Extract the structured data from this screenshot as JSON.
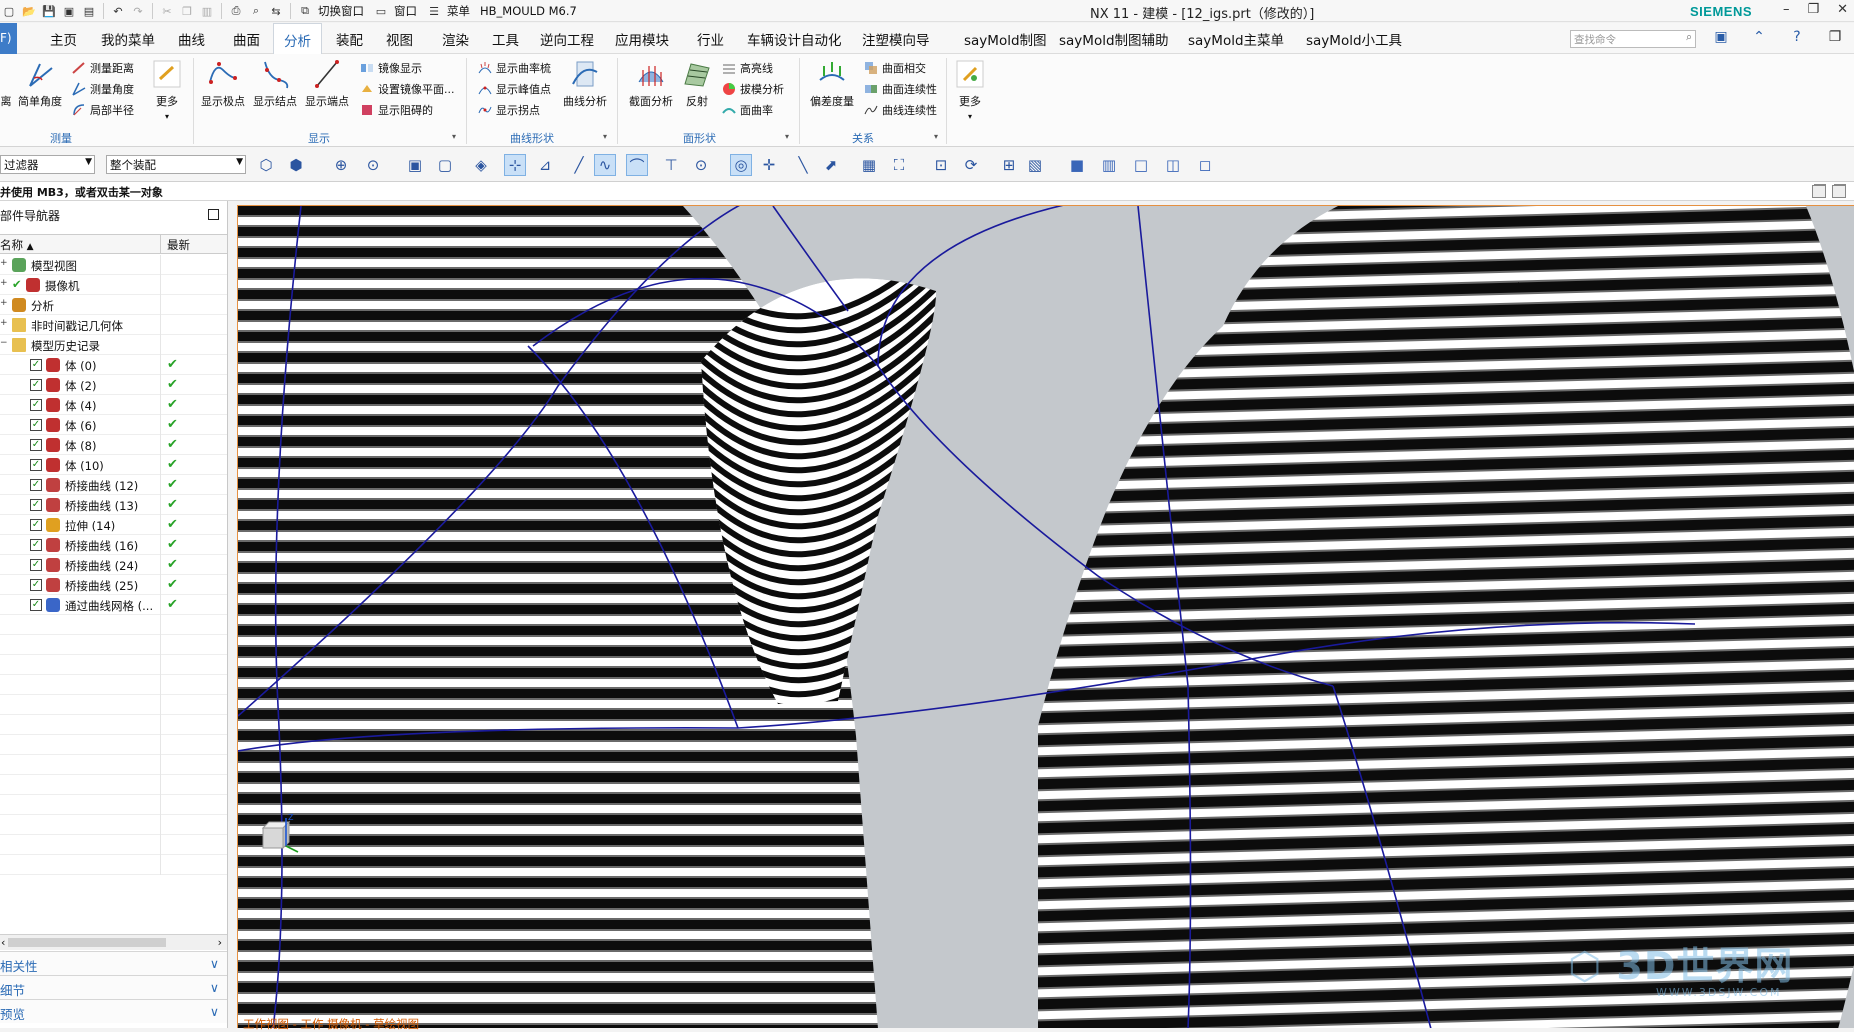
{
  "window": {
    "title": "NX 11 - 建模 - [12_igs.prt（修改的）]",
    "brand": "SIEMENS",
    "qa_switch_window": "切换窗口",
    "qa_window": "窗口",
    "qa_menu": "菜单",
    "qa_app": "HB_MOULD M6.7"
  },
  "menu": {
    "file": "F)",
    "tabs": [
      "主页",
      "我的菜单",
      "曲线",
      "曲面",
      "分析",
      "装配",
      "视图",
      "渲染",
      "工具",
      "逆向工程",
      "应用模块",
      "行业",
      "车辆设计自动化",
      "注塑模向导",
      "sayMold制图",
      "sayMold制图辅助",
      "sayMold主菜单",
      "sayMold小工具"
    ],
    "active_index": 4,
    "search_placeholder": "查找命令"
  },
  "ribbon": {
    "measure": {
      "group_label": "测量",
      "partial": "离",
      "simple_angle": "简单角度",
      "measure_distance": "测量距离",
      "measure_angle": "测量角度",
      "local_radius": "局部半径",
      "more": "更多"
    },
    "display": {
      "group_label": "显示",
      "show_poles": "显示极点",
      "show_knots": "显示结点",
      "show_endpoints": "显示端点",
      "mirror_display": "镜像显示",
      "set_mirror_plane": "设置镜像平面...",
      "show_thickness": "显示阻碍的"
    },
    "curve_shape": {
      "group_label": "曲线形状",
      "show_comb": "显示曲率梳",
      "show_peaks": "显示峰值点",
      "show_inflections": "显示拐点",
      "curve_analysis": "曲线分析"
    },
    "face_shape": {
      "group_label": "面形状",
      "section_analysis": "截面分析",
      "reflection": "反射",
      "highlight_lines": "高亮线",
      "draft_analysis": "拔模分析",
      "face_curvature": "面曲率"
    },
    "relation": {
      "group_label": "关系",
      "deviation": "偏差度量",
      "face_intersection": "曲面相交",
      "face_continuity": "曲面连续性",
      "curve_continuity": "曲线连续性"
    },
    "more": "更多"
  },
  "toolbar2": {
    "filter": "过滤器",
    "scope": "整个装配"
  },
  "prompt": "并使用 MB3，或者双击某一对象",
  "navigator": {
    "title": "部件导航器",
    "col_name": "名称",
    "col_latest": "最新",
    "items": [
      {
        "label": "模型视图",
        "indent": 0,
        "expander": "+",
        "checkbox": false,
        "latest": false,
        "icon": "model-views-icon"
      },
      {
        "label": "摄像机",
        "indent": 0,
        "expander": "+",
        "checkbox": false,
        "latest": false,
        "icon": "camera-icon"
      },
      {
        "label": "分析",
        "indent": 0,
        "expander": "+",
        "checkbox": false,
        "latest": false,
        "icon": "analysis-icon"
      },
      {
        "label": "非时间戳记几何体",
        "indent": 0,
        "expander": "+",
        "checkbox": false,
        "latest": false,
        "icon": "folder-icon"
      },
      {
        "label": "模型历史记录",
        "indent": 0,
        "expander": "-",
        "checkbox": false,
        "latest": false,
        "icon": "folder-icon"
      },
      {
        "label": "体 (0)",
        "indent": 1,
        "checkbox": true,
        "latest": true,
        "icon": "body-icon"
      },
      {
        "label": "体 (2)",
        "indent": 1,
        "checkbox": true,
        "latest": true,
        "icon": "body-icon"
      },
      {
        "label": "体 (4)",
        "indent": 1,
        "checkbox": true,
        "latest": true,
        "icon": "body-icon"
      },
      {
        "label": "体 (6)",
        "indent": 1,
        "checkbox": true,
        "latest": true,
        "icon": "body-icon"
      },
      {
        "label": "体 (8)",
        "indent": 1,
        "checkbox": true,
        "latest": true,
        "icon": "body-icon"
      },
      {
        "label": "体 (10)",
        "indent": 1,
        "checkbox": true,
        "latest": true,
        "icon": "body-icon"
      },
      {
        "label": "桥接曲线 (12)",
        "indent": 1,
        "checkbox": true,
        "latest": true,
        "icon": "bridge-curve-icon"
      },
      {
        "label": "桥接曲线 (13)",
        "indent": 1,
        "checkbox": true,
        "latest": true,
        "icon": "bridge-curve-icon"
      },
      {
        "label": "拉伸 (14)",
        "indent": 1,
        "checkbox": true,
        "latest": true,
        "icon": "extrude-icon"
      },
      {
        "label": "桥接曲线 (16)",
        "indent": 1,
        "checkbox": true,
        "latest": true,
        "icon": "bridge-curve-icon"
      },
      {
        "label": "桥接曲线 (24)",
        "indent": 1,
        "checkbox": true,
        "latest": true,
        "icon": "bridge-curve-icon"
      },
      {
        "label": "桥接曲线 (25)",
        "indent": 1,
        "checkbox": true,
        "latest": true,
        "icon": "bridge-curve-icon"
      },
      {
        "label": "通过曲线网格 (...",
        "indent": 1,
        "checkbox": true,
        "latest": true,
        "icon": "curve-mesh-icon"
      }
    ],
    "panels": [
      "相关性",
      "细节",
      "预览"
    ]
  },
  "viewport_status": "工作视图 - 工作 摄像机 - 草绘视图",
  "watermark": {
    "text": "3D世界网",
    "url": "WWW.3DSJW.COM"
  },
  "colors": {
    "accent": "#2b6bb5",
    "curve": "#1a1a9c",
    "check": "#29a329",
    "brand": "#009999"
  }
}
